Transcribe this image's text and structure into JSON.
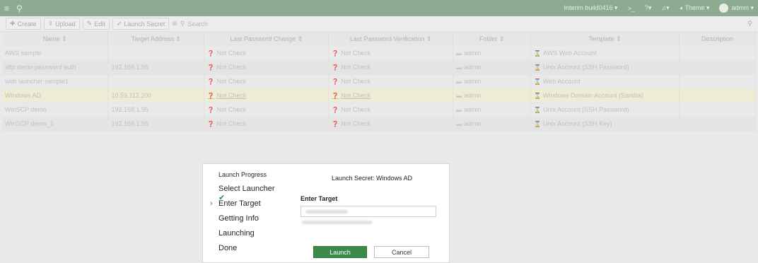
{
  "topbar": {
    "build": "Interim build0416 ▾",
    "terminal": ">_",
    "help": "?▾",
    "bell": "♫▾",
    "theme": "Theme ▾",
    "user": "admin ▾"
  },
  "toolbar": {
    "create": "Create",
    "upload": "Upload",
    "edit": "Edit",
    "launch_secret": "Launch Secret",
    "search_placeholder": "Search"
  },
  "table": {
    "headers": [
      "Name ⇕",
      "Target Address ⇕",
      "Last Password Change ⇕",
      "Last Password Verification ⇕",
      "Folder ⇕",
      "Template ⇕",
      "Description"
    ],
    "rows": [
      {
        "name": "AWS sample",
        "address": "",
        "change": "Not Check",
        "verify": "Not Check",
        "folder": "admin",
        "template": "AWS Web Account",
        "desc": ""
      },
      {
        "name": "sftp demo password auth",
        "address": "192.168.1.95",
        "change": "Not Check",
        "verify": "Not Check",
        "folder": "admin",
        "template": "Unix Account (SSH Password)",
        "desc": ""
      },
      {
        "name": "web launcher sample1",
        "address": "",
        "change": "Not Check",
        "verify": "Not Check",
        "folder": "admin",
        "template": "Web Account",
        "desc": ""
      },
      {
        "name": "Windows AD",
        "address": "10.59.112.200",
        "change": "Not Check",
        "verify": "Not Check",
        "folder": "admin",
        "template": "Windows Domain Account (Samba)",
        "desc": ""
      },
      {
        "name": "WinSCP demo",
        "address": "192.168.1.95",
        "change": "Not Check",
        "verify": "Not Check",
        "folder": "admin",
        "template": "Unix Account (SSH Password)",
        "desc": ""
      },
      {
        "name": "WinSCP demo_1",
        "address": "192.168.1.95",
        "change": "Not Check",
        "verify": "Not Check",
        "folder": "admin",
        "template": "Unix Account (SSH Key)",
        "desc": ""
      }
    ]
  },
  "dialog": {
    "progress_title": "Launch Progress",
    "steps": [
      "Select Launcher",
      "Enter Target",
      "Getting Info",
      "Launching",
      "Done"
    ],
    "current_step": 1,
    "title": "Launch Secret: Windows AD",
    "field_label": "Enter Target",
    "launch": "Launch",
    "cancel": "Cancel"
  }
}
